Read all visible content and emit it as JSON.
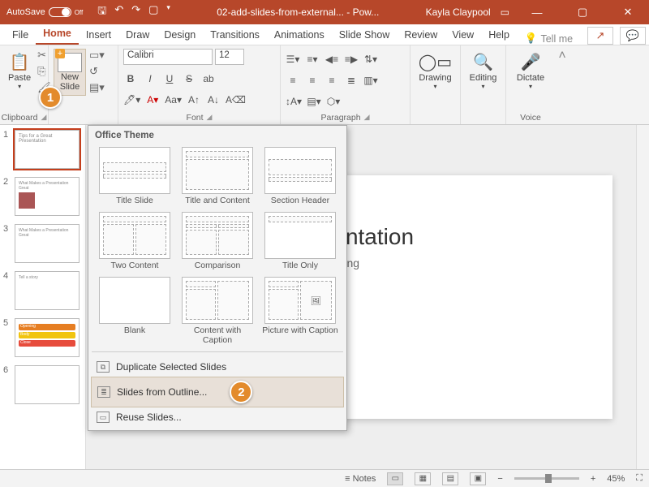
{
  "titlebar": {
    "autosave": "AutoSave",
    "autosave_state": "Off",
    "doc_title": "02-add-slides-from-external... - Pow...",
    "user": "Kayla Claypool"
  },
  "tabs": {
    "file": "File",
    "home": "Home",
    "insert": "Insert",
    "draw": "Draw",
    "design": "Design",
    "transitions": "Transitions",
    "animations": "Animations",
    "slideshow": "Slide Show",
    "review": "Review",
    "view": "View",
    "help": "Help",
    "tellme": "Tell me"
  },
  "ribbon": {
    "paste": "Paste",
    "clipboard_group": "Clipboard",
    "new_slide": "New\nSlide",
    "slides_group": "Slides",
    "font_name": "Calibri",
    "font_size": "12",
    "font_group": "Font",
    "paragraph_group": "Paragraph",
    "drawing": "Drawing",
    "editing": "Editing",
    "dictate": "Dictate",
    "voice_group": "Voice"
  },
  "callouts": {
    "one": "1",
    "two": "2"
  },
  "dropdown": {
    "header": "Office Theme",
    "layouts": [
      "Title Slide",
      "Title and Content",
      "Section Header",
      "Two Content",
      "Comparison",
      "Title Only",
      "Blank",
      "Content with Caption",
      "Picture with Caption"
    ],
    "dup": "Duplicate Selected Slides",
    "outline": "Slides from Outline...",
    "reuse": "Reuse Slides..."
  },
  "thumbs": {
    "n1": "1",
    "n2": "2",
    "n3": "3",
    "n4": "4",
    "n5": "5",
    "n6": "6",
    "t1": "Tips for a Great Presentation",
    "t2": "What Makes a Presentation Great",
    "t3": "What Makes a Presentation Great",
    "t4": "Tell a story",
    "b1": "Opening",
    "b2": "Body",
    "b3": "Close"
  },
  "slide": {
    "title": "Great Presentation",
    "subtitle": "mguide Interactive Training"
  },
  "statusbar": {
    "notes": "Notes",
    "zoom": "45%",
    "minus": "−",
    "plus": "+"
  }
}
